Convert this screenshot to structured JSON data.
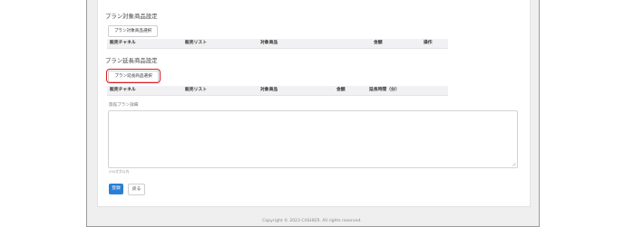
{
  "plan_target": {
    "title": "プラン対象商品設定",
    "select_button": "プラン対象商品選択",
    "columns": [
      "販売チャネル",
      "販売リスト",
      "対象商品",
      "金額",
      "操作"
    ]
  },
  "plan_extension": {
    "title": "プラン延長商品設定",
    "select_button": "プラン延長商品選択",
    "columns": [
      "販売チャネル",
      "販売リスト",
      "対象商品",
      "金額",
      "延長時間（分）"
    ]
  },
  "details": {
    "label": "旅館プラン詳細",
    "value": "",
    "hint": "250文字以内"
  },
  "actions": {
    "register": "登録",
    "back": "戻る"
  },
  "footer": {
    "copyright": "Copyright © 2023 CASHIER. All rights reserved."
  },
  "colors": {
    "primary": "#2a7fd4",
    "highlight": "#e0191e",
    "table_header": "#f1f1f3",
    "background": "#efeff0"
  }
}
